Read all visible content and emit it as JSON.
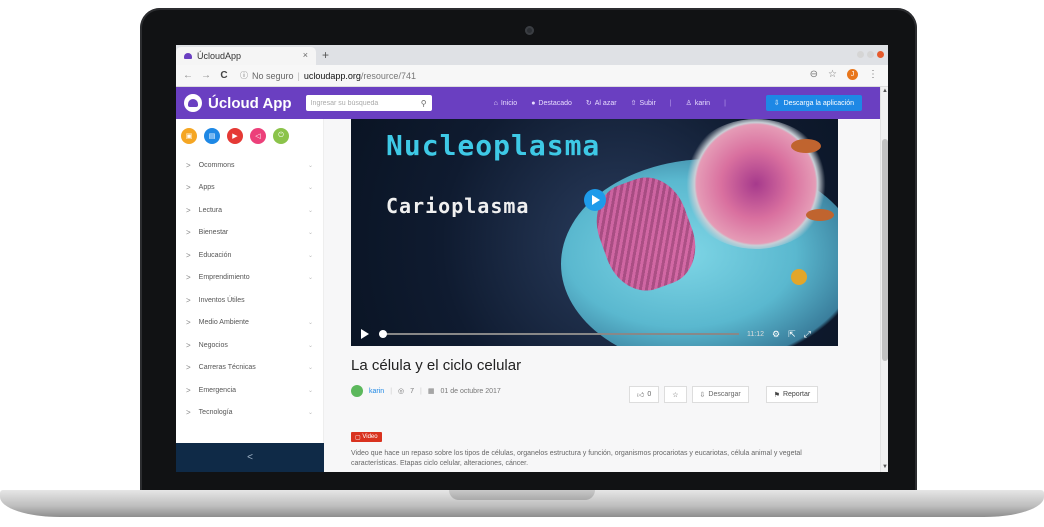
{
  "browser": {
    "tab_title": "ÚcloudApp",
    "tab_close": "×",
    "new_tab": "+",
    "back": "←",
    "forward": "→",
    "reload": "C",
    "security": "No seguro",
    "url_domain": "ucloudapp.org",
    "url_path": "/resource/741",
    "zoom_icon": "⊖",
    "star_icon": "☆",
    "profile_initial": "J",
    "menu_icon": "⋮"
  },
  "header": {
    "logo_text": "Úcloud App",
    "search_placeholder": "Ingresar su búsqueda",
    "menu": [
      {
        "icon": "home-icon",
        "label": "Inicio"
      },
      {
        "icon": "flame-icon",
        "label": "Destacado"
      },
      {
        "icon": "refresh-icon",
        "label": "Al azar"
      },
      {
        "icon": "upload-icon",
        "label": "Subir"
      },
      {
        "icon": "user-icon",
        "label": "karin"
      }
    ],
    "download_app": "Descarga la aplicación"
  },
  "sidebar": {
    "categories": [
      {
        "icon": "image-icon",
        "color": "#f5a623"
      },
      {
        "icon": "document-icon",
        "color": "#1e88e5"
      },
      {
        "icon": "video-icon",
        "color": "#e53935"
      },
      {
        "icon": "audio-icon",
        "color": "#ec407a"
      },
      {
        "icon": "power-icon",
        "color": "#8bc34a"
      }
    ],
    "items": [
      "Ocommons",
      "Apps",
      "Lectura",
      "Bienestar",
      "Educación",
      "Emprendimiento",
      "Inventos Útiles",
      "Medio Ambiente",
      "Negocios",
      "Carreras Técnicas",
      "Emergencia",
      "Tecnología"
    ],
    "collapse_label": "<"
  },
  "video": {
    "overlay_title": "Nucleoplasma",
    "overlay_subtitle": "Carioplasma",
    "time": "11:12",
    "progress": 0.0
  },
  "resource": {
    "title": "La célula y el ciclo celular",
    "author": "karin",
    "views": "7",
    "date": "01 de octubre 2017",
    "likes": "0",
    "download_label": "Descargar",
    "report_label": "Reportar",
    "badge": "Video",
    "description": "Video que hace un repaso sobre los tipos de células, organelos estructura y función, organismos procariotas y eucariotas, célula animal y vegetal características. Etapas ciclo celular, alteraciones, cáncer."
  }
}
